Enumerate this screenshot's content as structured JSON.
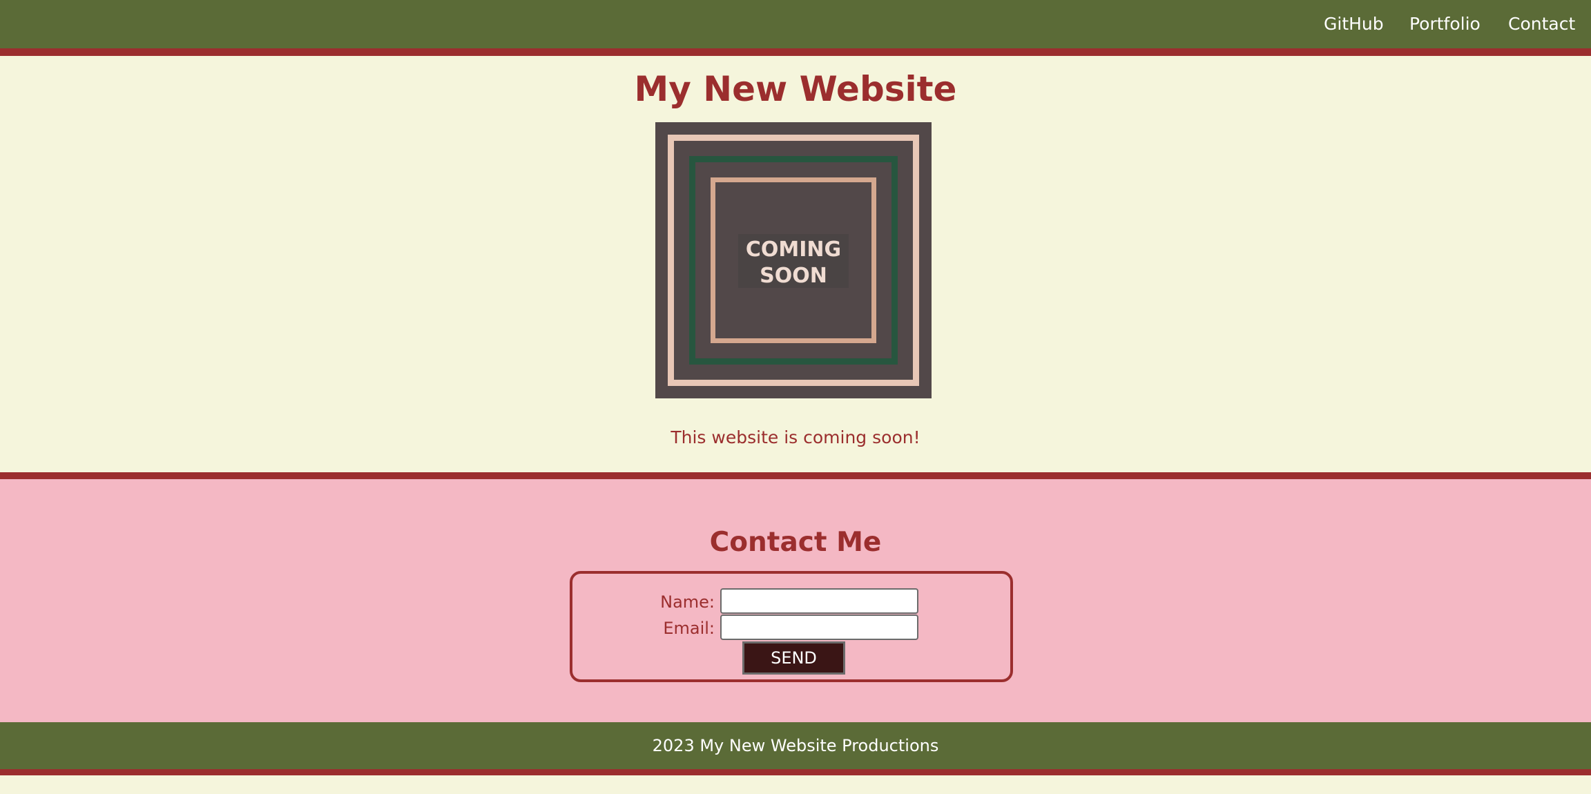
{
  "nav": {
    "links": [
      {
        "label": "GitHub"
      },
      {
        "label": "Portfolio"
      },
      {
        "label": "Contact"
      }
    ]
  },
  "main": {
    "title": "My New Website",
    "image": {
      "line1": "COMING",
      "line2": "SOON",
      "icon": "coming-soon-image"
    },
    "message": "This website is coming soon!"
  },
  "contact": {
    "title": "Contact Me",
    "name_label": "Name:",
    "email_label": "Email:",
    "name_value": "",
    "email_value": "",
    "send_label": "SEND"
  },
  "footer": {
    "text": "2023 My New Website Productions"
  },
  "colors": {
    "nav_bg": "#5b6b37",
    "accent": "#9b2e2e",
    "page_bg": "#f5f5dc",
    "contact_bg": "#f4b8c4",
    "button_bg": "#3a1515"
  }
}
